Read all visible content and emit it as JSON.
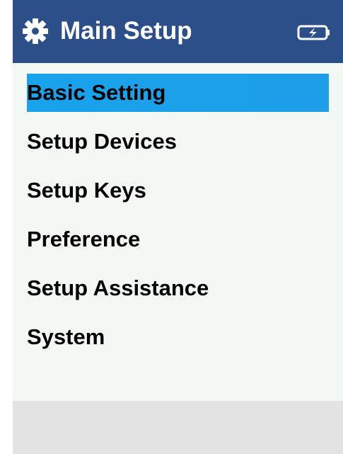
{
  "header": {
    "title": "Main Setup",
    "settings_icon": "gear-icon",
    "battery_icon": "battery-charging-icon"
  },
  "menu": {
    "items": [
      {
        "label": "Basic Setting",
        "selected": true
      },
      {
        "label": "Setup Devices",
        "selected": false
      },
      {
        "label": "Setup Keys",
        "selected": false
      },
      {
        "label": "Preference",
        "selected": false
      },
      {
        "label": "Setup Assistance",
        "selected": false
      },
      {
        "label": "System",
        "selected": false
      }
    ]
  },
  "colors": {
    "header_bg": "#2c4f8a",
    "selection": "#1aa2ea",
    "screen_bg": "#f4f8f5",
    "footer_bg": "#e3e3e3"
  }
}
